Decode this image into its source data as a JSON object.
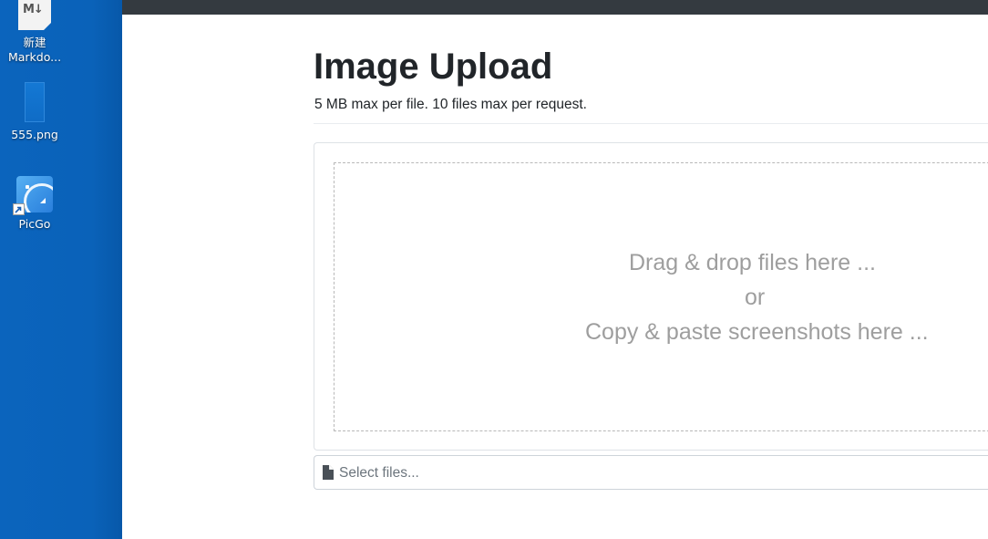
{
  "desktop": {
    "icons": [
      {
        "label_line1": "新建",
        "label_line2": "Markdo...",
        "icon": "markdown-file-icon"
      },
      {
        "label": "555.png",
        "icon": "image-file-icon"
      },
      {
        "label": "PicGo",
        "icon": "picgo-app-icon"
      }
    ]
  },
  "page": {
    "title": "Image Upload",
    "subtitle": "5 MB max per file. 10 files max per request.",
    "drop_zone": {
      "line1": "Drag & drop files here ...",
      "line2": "or",
      "line3": "Copy & paste screenshots here ..."
    },
    "file_picker": {
      "label": "Select files...",
      "icon": "file-icon"
    }
  },
  "colors": {
    "desktop_bg": "#0b64bd",
    "topbar": "#343a40",
    "title": "#212529",
    "muted_text": "#9e9e9e",
    "placeholder": "#6c757d"
  }
}
